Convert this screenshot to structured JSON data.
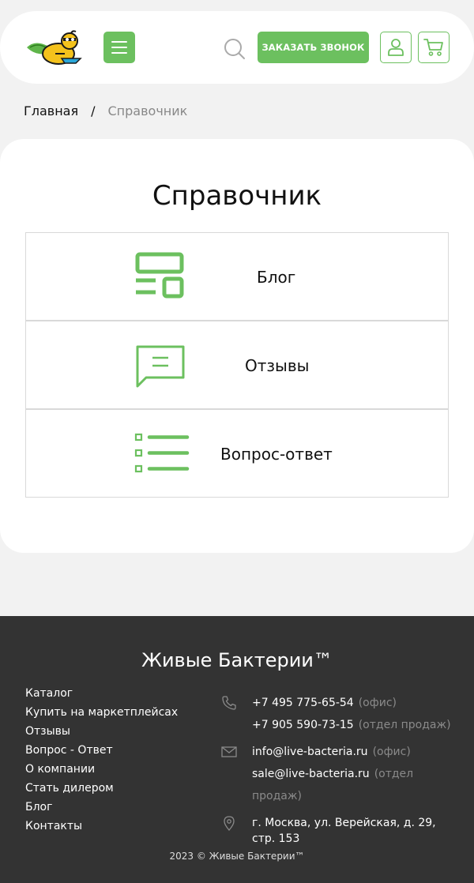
{
  "header": {
    "call_button": "ЗАКАЗАТЬ ЗВОНОК",
    "accent_color": "#6cc05f"
  },
  "breadcrumb": {
    "home": "Главная",
    "separator": "/",
    "current": "Справочник"
  },
  "main": {
    "title": "Справочник",
    "items": [
      {
        "label": "Блог",
        "icon": "blog-layout-icon"
      },
      {
        "label": "Отзывы",
        "icon": "chat-bubble-icon"
      },
      {
        "label": "Вопрос-ответ",
        "icon": "checklist-icon"
      }
    ]
  },
  "footer": {
    "brand": "Живые Бактерии™",
    "links": [
      "Каталог",
      "Купить на маркетплейсах",
      "Отзывы",
      "Вопрос - Ответ",
      "О компании",
      "Стать дилером",
      "Блог",
      "Контакты"
    ],
    "phones": [
      {
        "value": "+7 495 775-65-54",
        "note": "(офис)"
      },
      {
        "value": "+7 905 590-73-15",
        "note": "(отдел продаж)"
      }
    ],
    "emails": [
      {
        "value": "info@live-bacteria.ru",
        "note": "(офис)"
      },
      {
        "value": "sale@live-bacteria.ru",
        "note": "(отдел продаж)"
      }
    ],
    "address_line1": "г. Москва, ул. Верейская, д. 29,",
    "address_line2": "стр. 153",
    "copyright": "2023 © Живые Бактерии™",
    "background_color": "#333333"
  }
}
